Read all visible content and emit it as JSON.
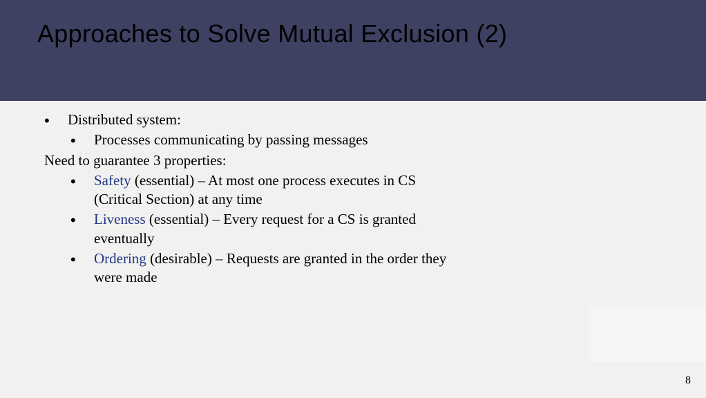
{
  "title": "Approaches to Solve Mutual Exclusion (2)",
  "body": {
    "l0a": "Distributed system:",
    "l1a": "Processes communicating by passing messages",
    "line2": "Need to guarantee 3 properties:",
    "prop1_term": "Safety",
    "prop1_rest": " (essential) – At most one process executes in CS (Critical Section) at any time",
    "prop2_term": "Liveness",
    "prop2_rest": " (essential) – Every request for a CS is granted eventually",
    "prop3_term": "Ordering",
    "prop3_rest": " (desirable) – Requests are granted in the order they were made"
  },
  "page_number": "8"
}
